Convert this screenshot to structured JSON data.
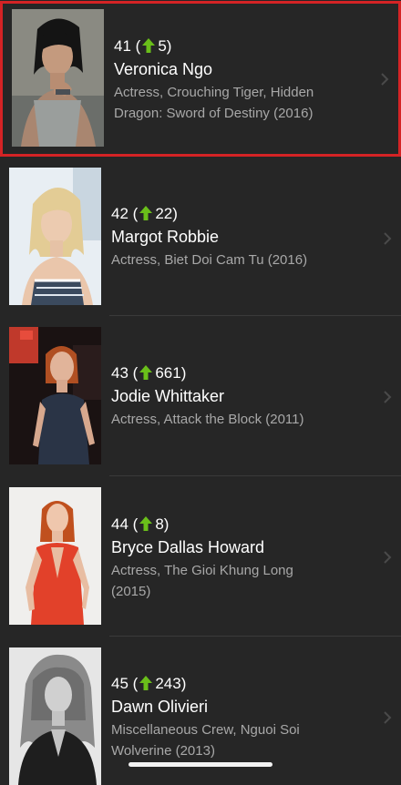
{
  "colors": {
    "background": "#262626",
    "rank_up": "#6abf1a",
    "selection_border": "#d42325",
    "secondary_text": "#a8a8a8"
  },
  "items": [
    {
      "rank": "41",
      "paren_open": "(",
      "change": "5)",
      "change_icon": "arrow-up-icon",
      "name": "Veronica Ngo",
      "description": "Actress, Crouching Tiger, Hidden Dragon: Sword of Destiny (2016)",
      "photo": "headshot-veronica-ngo"
    },
    {
      "rank": "42",
      "paren_open": "(",
      "change": "22)",
      "change_icon": "arrow-up-icon",
      "name": "Margot Robbie",
      "description": "Actress, Biet Doi Cam Tu (2016)",
      "photo": "headshot-margot-robbie"
    },
    {
      "rank": "43",
      "paren_open": "(",
      "change": "661)",
      "change_icon": "arrow-up-icon",
      "name": "Jodie Whittaker",
      "description": "Actress, Attack the Block (2011)",
      "photo": "headshot-jodie-whittaker"
    },
    {
      "rank": "44",
      "paren_open": "(",
      "change": "8)",
      "change_icon": "arrow-up-icon",
      "name": "Bryce Dallas Howard",
      "description": "Actress, The Gioi Khung Long (2015)",
      "photo": "headshot-bryce-dallas-howard"
    },
    {
      "rank": "45",
      "paren_open": "(",
      "change": "243)",
      "change_icon": "arrow-up-icon",
      "name": "Dawn Olivieri",
      "description": "Miscellaneous Crew, Nguoi Soi Wolverine (2013)",
      "photo": "headshot-dawn-olivieri"
    }
  ]
}
